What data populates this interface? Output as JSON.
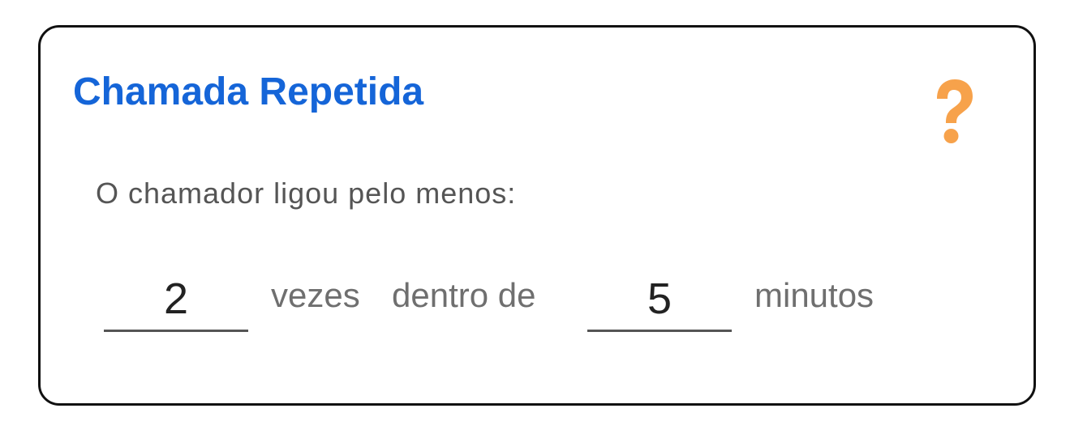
{
  "card": {
    "title": "Chamada Repetida",
    "help_icon": "question-mark-icon",
    "subtitle": "O chamador ligou pelo menos:",
    "times_value": "2",
    "times_label": "vezes",
    "within_label": "dentro de",
    "minutes_value": "5",
    "minutes_label": "minutos"
  },
  "colors": {
    "title": "#1565d8",
    "help_icon": "#f7a24b",
    "border": "#111111",
    "text_muted": "#6f6f6f"
  }
}
